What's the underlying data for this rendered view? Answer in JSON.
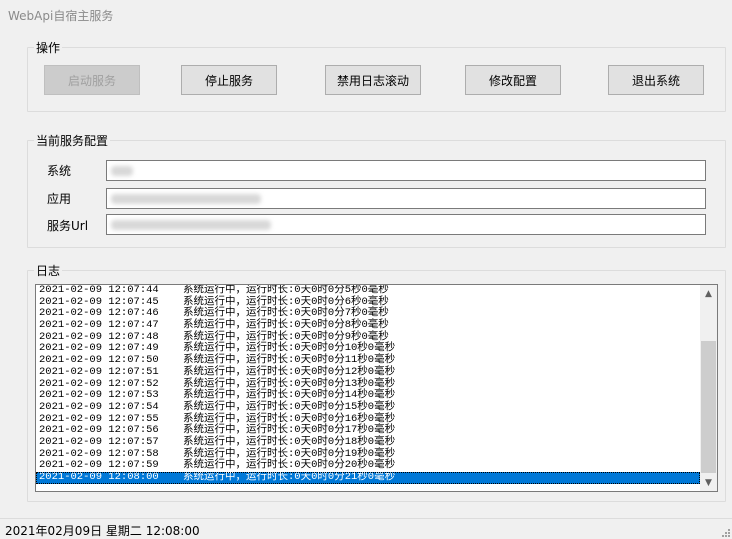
{
  "window": {
    "title": "WebApi自宿主服务"
  },
  "ops": {
    "title": "操作",
    "buttons": [
      "启动服务",
      "停止服务",
      "禁用日志滚动",
      "修改配置",
      "退出系统"
    ]
  },
  "config": {
    "title": "当前服务配置",
    "system_label": "系统",
    "app_label": "应用",
    "url_label": "服务Url"
  },
  "log": {
    "title": "日志",
    "lines": [
      {
        "time": "2021-02-09 12:07:44",
        "msg": "系统运行中，运行时长:0天0时0分5秒0毫秒"
      },
      {
        "time": "2021-02-09 12:07:45",
        "msg": "系统运行中，运行时长:0天0时0分6秒0毫秒"
      },
      {
        "time": "2021-02-09 12:07:46",
        "msg": "系统运行中，运行时长:0天0时0分7秒0毫秒"
      },
      {
        "time": "2021-02-09 12:07:47",
        "msg": "系统运行中，运行时长:0天0时0分8秒0毫秒"
      },
      {
        "time": "2021-02-09 12:07:48",
        "msg": "系统运行中，运行时长:0天0时0分9秒0毫秒"
      },
      {
        "time": "2021-02-09 12:07:49",
        "msg": "系统运行中，运行时长:0天0时0分10秒0毫秒"
      },
      {
        "time": "2021-02-09 12:07:50",
        "msg": "系统运行中，运行时长:0天0时0分11秒0毫秒"
      },
      {
        "time": "2021-02-09 12:07:51",
        "msg": "系统运行中，运行时长:0天0时0分12秒0毫秒"
      },
      {
        "time": "2021-02-09 12:07:52",
        "msg": "系统运行中，运行时长:0天0时0分13秒0毫秒"
      },
      {
        "time": "2021-02-09 12:07:53",
        "msg": "系统运行中，运行时长:0天0时0分14秒0毫秒"
      },
      {
        "time": "2021-02-09 12:07:54",
        "msg": "系统运行中，运行时长:0天0时0分15秒0毫秒"
      },
      {
        "time": "2021-02-09 12:07:55",
        "msg": "系统运行中，运行时长:0天0时0分16秒0毫秒"
      },
      {
        "time": "2021-02-09 12:07:56",
        "msg": "系统运行中，运行时长:0天0时0分17秒0毫秒"
      },
      {
        "time": "2021-02-09 12:07:57",
        "msg": "系统运行中，运行时长:0天0时0分18秒0毫秒"
      },
      {
        "time": "2021-02-09 12:07:58",
        "msg": "系统运行中，运行时长:0天0时0分19秒0毫秒"
      },
      {
        "time": "2021-02-09 12:07:59",
        "msg": "系统运行中，运行时长:0天0时0分20秒0毫秒"
      },
      {
        "time": "2021-02-09 12:08:00",
        "msg": "系统运行中，运行时长:0天0时0分21秒0毫秒"
      }
    ]
  },
  "status": {
    "text": "2021年02月09日 星期二 12:08:00"
  },
  "colors": {
    "selection": "#0078d7",
    "window_bg": "#f0f0f0"
  }
}
